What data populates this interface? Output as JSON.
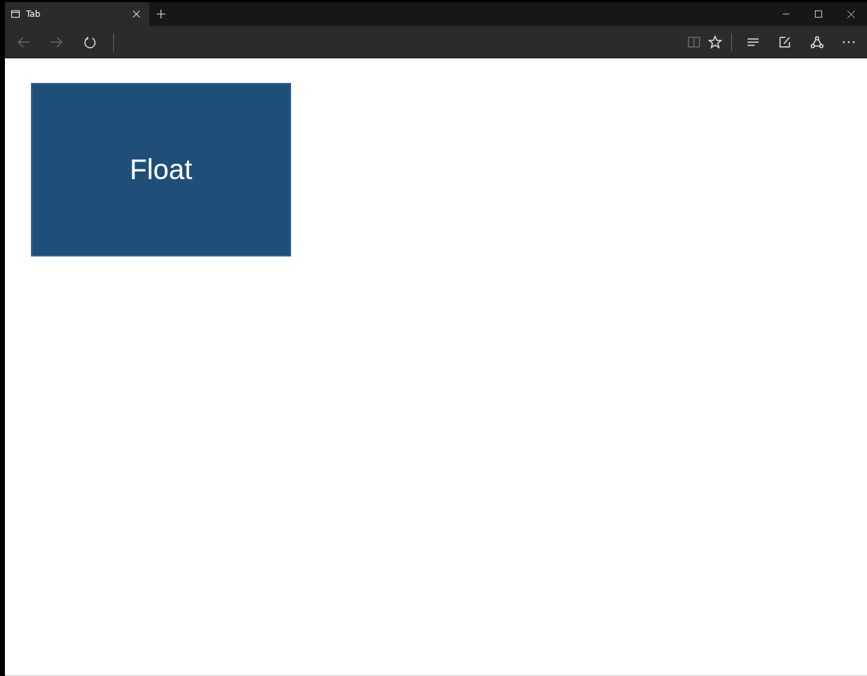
{
  "tab": {
    "title": "Tab",
    "selected": true
  },
  "toolbar": {
    "back_disabled": true,
    "forward_disabled": true,
    "reading_view_disabled": true
  },
  "page": {
    "box_label": "Float"
  }
}
